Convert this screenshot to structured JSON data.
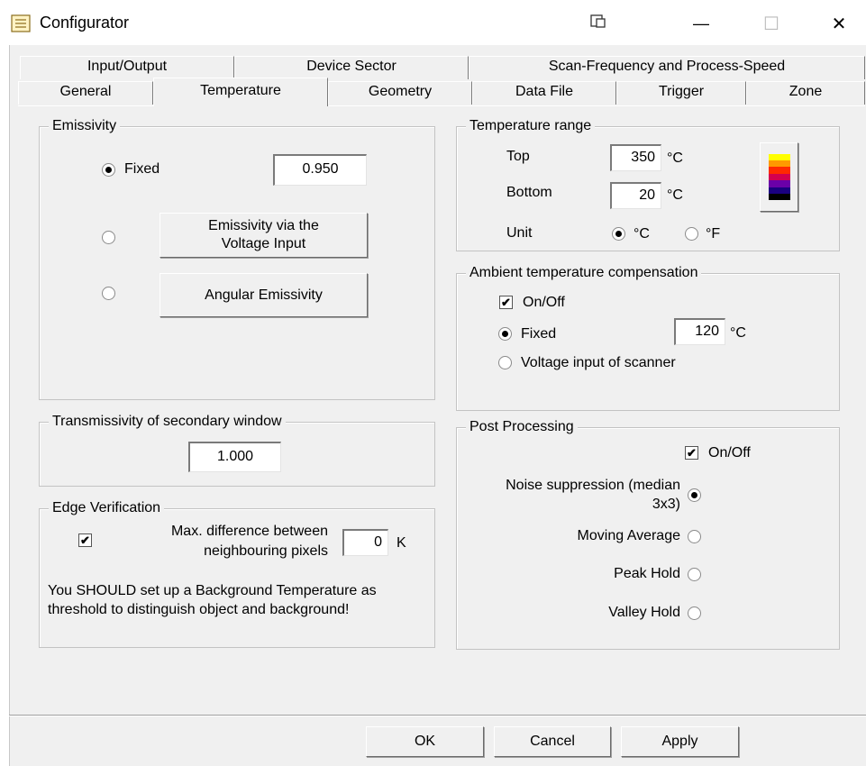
{
  "window": {
    "title": "Configurator",
    "minimize_glyph": "—",
    "maximize_glyph": "☐",
    "close_glyph": "✕"
  },
  "tabs": {
    "row1": [
      "Input/Output",
      "Device Sector",
      "Scan-Frequency and Process-Speed"
    ],
    "row2": [
      "General",
      "Temperature",
      "Geometry",
      "Data File",
      "Trigger",
      "Zone"
    ],
    "active": "Temperature"
  },
  "emissivity": {
    "title": "Emissivity",
    "fixed_label": "Fixed",
    "fixed_value": "0.950",
    "voltage_button": [
      "Emissivity via the",
      "Voltage Input"
    ],
    "angular_button": "Angular Emissivity",
    "selected": "fixed"
  },
  "transmissivity": {
    "title": "Transmissivity of secondary window",
    "value": "1.000"
  },
  "edge": {
    "title": "Edge Verification",
    "checked": true,
    "max_diff_label": [
      "Max. difference between",
      "neighbouring pixels"
    ],
    "max_diff_value": "0",
    "unit": "K",
    "note": [
      "You SHOULD set up a Background Temperature as",
      "threshold to distinguish object and background!"
    ]
  },
  "temp_range": {
    "title": "Temperature range",
    "top_label": "Top",
    "top_value": "350",
    "bottom_label": "Bottom",
    "bottom_value": "20",
    "deg_c": "°C",
    "unit_label": "Unit",
    "unit_c": "°C",
    "unit_f": "°F",
    "unit_selected": "C",
    "palette_colors": [
      "#ffff00",
      "#ff9900",
      "#ff2a00",
      "#d4004f",
      "#6a00a8",
      "#1a0080",
      "#000000"
    ]
  },
  "ambient": {
    "title": "Ambient temperature compensation",
    "onoff_label": "On/Off",
    "onoff_checked": true,
    "fixed_label": "Fixed",
    "fixed_value": "120",
    "unit": "°C",
    "voltage_label": "Voltage input of scanner",
    "selected": "fixed"
  },
  "post": {
    "title": "Post Processing",
    "onoff_label": "On/Off",
    "onoff_checked": true,
    "options": [
      [
        "Noise suppression (median",
        "3x3)"
      ],
      [
        "Moving Average"
      ],
      [
        "Peak Hold"
      ],
      [
        "Valley Hold"
      ]
    ],
    "selected_index": 0
  },
  "buttons": {
    "ok": "OK",
    "cancel": "Cancel",
    "apply": "Apply"
  }
}
